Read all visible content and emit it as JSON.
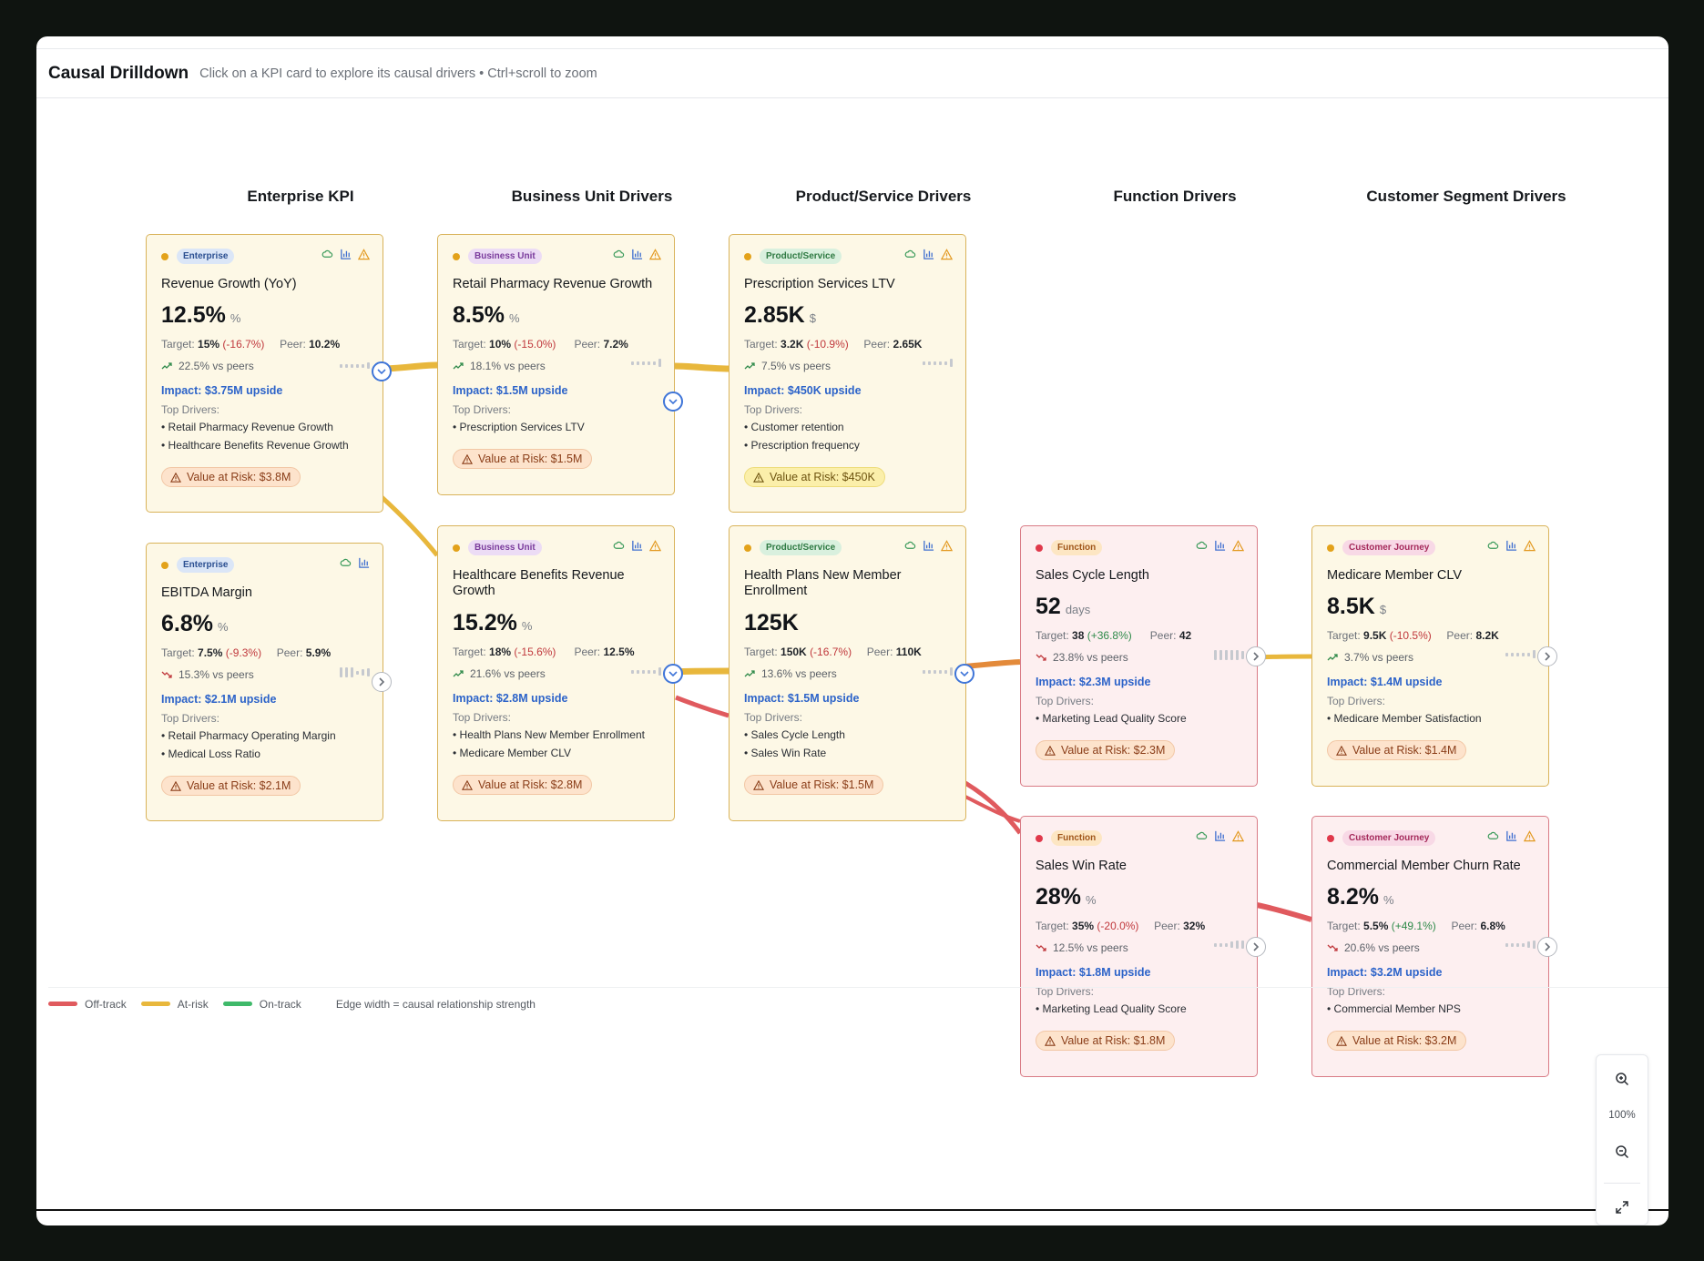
{
  "header": {
    "title": "Causal Drilldown",
    "subtitle": "Click on a KPI card to explore its causal drivers • Ctrl+scroll to zoom"
  },
  "columns": [
    "Enterprise KPI",
    "Business Unit Drivers",
    "Product/Service Drivers",
    "Function Drivers",
    "Customer Segment Drivers"
  ],
  "colors": {
    "off_track": "#e05a5e",
    "at_risk": "#e8b73c",
    "on_track": "#3fb96a",
    "impact": "#2c63c9"
  },
  "cards": {
    "rev": {
      "badge": "Enterprise",
      "name": "Revenue Growth (YoY)",
      "value": "12.5%",
      "unit": "%",
      "target_label": "Target:",
      "target": "15%",
      "target_delta": "(-16.7%)",
      "peer_label": "Peer:",
      "peer": "10.2%",
      "vs_peers": "22.5% vs peers",
      "impact": "Impact: $3.75M upside",
      "top_drivers_label": "Top Drivers:",
      "drivers": [
        "• Retail Pharmacy Revenue Growth",
        "• Healthcare Benefits Revenue Growth"
      ],
      "risk": "Value at Risk: $3.8M"
    },
    "ebitda": {
      "badge": "Enterprise",
      "name": "EBITDA Margin",
      "value": "6.8%",
      "unit": "%",
      "target_label": "Target:",
      "target": "7.5%",
      "target_delta": "(-9.3%)",
      "peer_label": "Peer:",
      "peer": "5.9%",
      "vs_peers": "15.3% vs peers",
      "impact": "Impact: $2.1M upside",
      "top_drivers_label": "Top Drivers:",
      "drivers": [
        "• Retail Pharmacy Operating Margin",
        "• Medical Loss Ratio"
      ],
      "risk": "Value at Risk: $2.1M"
    },
    "retail": {
      "badge": "Business Unit",
      "name": "Retail Pharmacy Revenue Growth",
      "value": "8.5%",
      "unit": "%",
      "target_label": "Target:",
      "target": "10%",
      "target_delta": "(-15.0%)",
      "peer_label": "Peer:",
      "peer": "7.2%",
      "vs_peers": "18.1% vs peers",
      "impact": "Impact: $1.5M upside",
      "top_drivers_label": "Top Drivers:",
      "drivers": [
        "• Prescription Services LTV"
      ],
      "risk": "Value at Risk: $1.5M"
    },
    "hcb": {
      "badge": "Business Unit",
      "name": "Healthcare Benefits Revenue Growth",
      "value": "15.2%",
      "unit": "%",
      "target_label": "Target:",
      "target": "18%",
      "target_delta": "(-15.6%)",
      "peer_label": "Peer:",
      "peer": "12.5%",
      "vs_peers": "21.6% vs peers",
      "impact": "Impact: $2.8M upside",
      "top_drivers_label": "Top Drivers:",
      "drivers": [
        "• Health Plans New Member Enrollment",
        "• Medicare Member CLV"
      ],
      "risk": "Value at Risk: $2.8M"
    },
    "rx": {
      "badge": "Product/Service",
      "name": "Prescription Services LTV",
      "value": "2.85K",
      "unit": "$",
      "target_label": "Target:",
      "target": "3.2K",
      "target_delta": "(-10.9%)",
      "peer_label": "Peer:",
      "peer": "2.65K",
      "vs_peers": "7.5% vs peers",
      "impact": "Impact: $450K upside",
      "top_drivers_label": "Top Drivers:",
      "drivers": [
        "• Customer retention",
        "• Prescription frequency"
      ],
      "risk": "Value at Risk: $450K"
    },
    "hp": {
      "badge": "Product/Service",
      "name": "Health Plans New Member Enrollment",
      "value": "125K",
      "unit": "",
      "target_label": "Target:",
      "target": "150K",
      "target_delta": "(-16.7%)",
      "peer_label": "Peer:",
      "peer": "110K",
      "vs_peers": "13.6% vs peers",
      "impact": "Impact: $1.5M upside",
      "top_drivers_label": "Top Drivers:",
      "drivers": [
        "• Sales Cycle Length",
        "• Sales Win Rate"
      ],
      "risk": "Value at Risk: $1.5M"
    },
    "scl": {
      "badge": "Function",
      "name": "Sales Cycle Length",
      "value": "52",
      "unit": "days",
      "target_label": "Target:",
      "target": "38",
      "target_delta": "(+36.8%)",
      "peer_label": "Peer:",
      "peer": "42",
      "vs_peers": "23.8% vs peers",
      "impact": "Impact: $2.3M upside",
      "top_drivers_label": "Top Drivers:",
      "drivers": [
        "• Marketing Lead Quality Score"
      ],
      "risk": "Value at Risk: $2.3M"
    },
    "swr": {
      "badge": "Function",
      "name": "Sales Win Rate",
      "value": "28%",
      "unit": "%",
      "target_label": "Target:",
      "target": "35%",
      "target_delta": "(-20.0%)",
      "peer_label": "Peer:",
      "peer": "32%",
      "vs_peers": "12.5% vs peers",
      "impact": "Impact: $1.8M upside",
      "top_drivers_label": "Top Drivers:",
      "drivers": [
        "• Marketing Lead Quality Score"
      ],
      "risk": "Value at Risk: $1.8M"
    },
    "mclv": {
      "badge": "Customer Journey",
      "name": "Medicare Member CLV",
      "value": "8.5K",
      "unit": "$",
      "target_label": "Target:",
      "target": "9.5K",
      "target_delta": "(-10.5%)",
      "peer_label": "Peer:",
      "peer": "8.2K",
      "vs_peers": "3.7% vs peers",
      "impact": "Impact: $1.4M upside",
      "top_drivers_label": "Top Drivers:",
      "drivers": [
        "• Medicare Member Satisfaction"
      ],
      "risk": "Value at Risk: $1.4M"
    },
    "churn": {
      "badge": "Customer Journey",
      "name": "Commercial Member Churn Rate",
      "value": "8.2%",
      "unit": "%",
      "target_label": "Target:",
      "target": "5.5%",
      "target_delta": "(+49.1%)",
      "peer_label": "Peer:",
      "peer": "6.8%",
      "vs_peers": "20.6% vs peers",
      "impact": "Impact: $3.2M upside",
      "top_drivers_label": "Top Drivers:",
      "drivers": [
        "• Commercial Member NPS"
      ],
      "risk": "Value at Risk: $3.2M"
    }
  },
  "legend": {
    "off_track": "Off-track",
    "at_risk": "At-risk",
    "on_track": "On-track",
    "note": "Edge width = causal relationship strength"
  },
  "zoom": {
    "level": "100%"
  }
}
